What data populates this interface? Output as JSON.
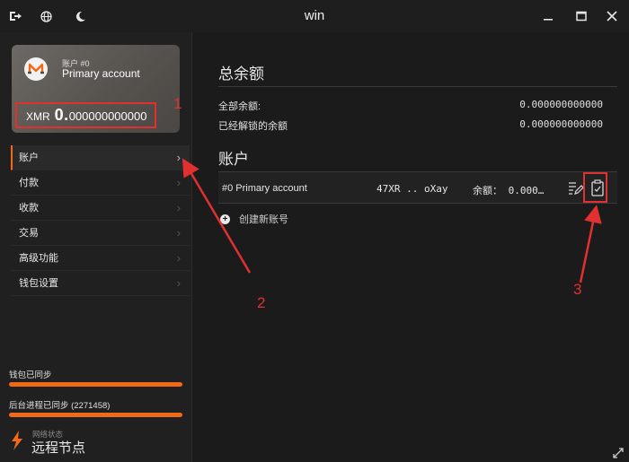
{
  "window": {
    "title": "win"
  },
  "titlebar": {
    "left_icons": [
      "logout-icon",
      "globe-icon",
      "moon-icon"
    ],
    "right_icons": [
      "minimize-icon",
      "maximize-icon",
      "close-icon"
    ]
  },
  "account_card": {
    "account_index": "账户 #0",
    "account_name": "Primary account",
    "currency": "XMR",
    "balance_int": "0.",
    "balance_dec": "000000000000"
  },
  "nav": {
    "items": [
      {
        "label": "账户",
        "active": true
      },
      {
        "label": "付款",
        "active": false
      },
      {
        "label": "收款",
        "active": false
      },
      {
        "label": "交易",
        "active": false
      },
      {
        "label": "高级功能",
        "active": false
      },
      {
        "label": "钱包设置",
        "active": false
      }
    ]
  },
  "sync": {
    "wallet_label": "钱包已同步",
    "daemon_label": "后台进程已同步 (2271458)",
    "wallet_progress": 1.0,
    "daemon_progress": 1.0
  },
  "network": {
    "status_label": "网络状态",
    "mode": "远程节点"
  },
  "main": {
    "balance_title": "总余额",
    "total_balance_label": "全部余额:",
    "total_balance_value": "0.000000000000",
    "unlocked_balance_label": "已经解锁的余额",
    "unlocked_balance_value": "0.000000000000",
    "accounts_title": "账户",
    "accounts": [
      {
        "name": "#0 Primary account",
        "address": "47XR .. oXay",
        "balance": "余额： 0.000…"
      }
    ],
    "create_account_label": "创建新账号"
  },
  "annotations": {
    "num1": "1",
    "num2": "2",
    "num3": "3",
    "color": "#e03030"
  },
  "colors": {
    "accent": "#f26a18",
    "background": "#1b1b1b",
    "sidebar": "#202020"
  }
}
